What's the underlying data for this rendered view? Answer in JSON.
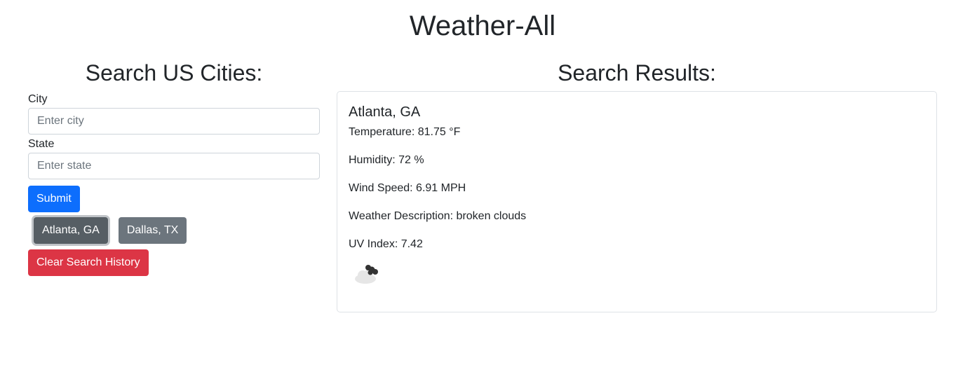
{
  "header": {
    "title": "Weather-All"
  },
  "search": {
    "heading": "Search US Cities:",
    "city_label": "City",
    "city_placeholder": "Enter city",
    "city_value": "",
    "state_label": "State",
    "state_placeholder": "Enter state",
    "state_value": "",
    "submit_label": "Submit",
    "history": [
      {
        "label": "Atlanta, GA",
        "active": true
      },
      {
        "label": "Dallas, TX",
        "active": false
      }
    ],
    "clear_label": "Clear Search History"
  },
  "results": {
    "heading": "Search Results:",
    "city": "Atlanta, GA",
    "temperature": "Temperature: 81.75 °F",
    "humidity": "Humidity: 72 %",
    "wind_speed": "Wind Speed: 6.91 MPH",
    "description": "Weather Description: broken clouds",
    "uv_index": "UV Index: 7.42",
    "icon": "broken-clouds-icon"
  },
  "colors": {
    "primary": "#0d6efd",
    "secondary": "#6c757d",
    "secondary_active": "#565e64",
    "danger": "#dc3545",
    "border": "#dee2e6"
  }
}
